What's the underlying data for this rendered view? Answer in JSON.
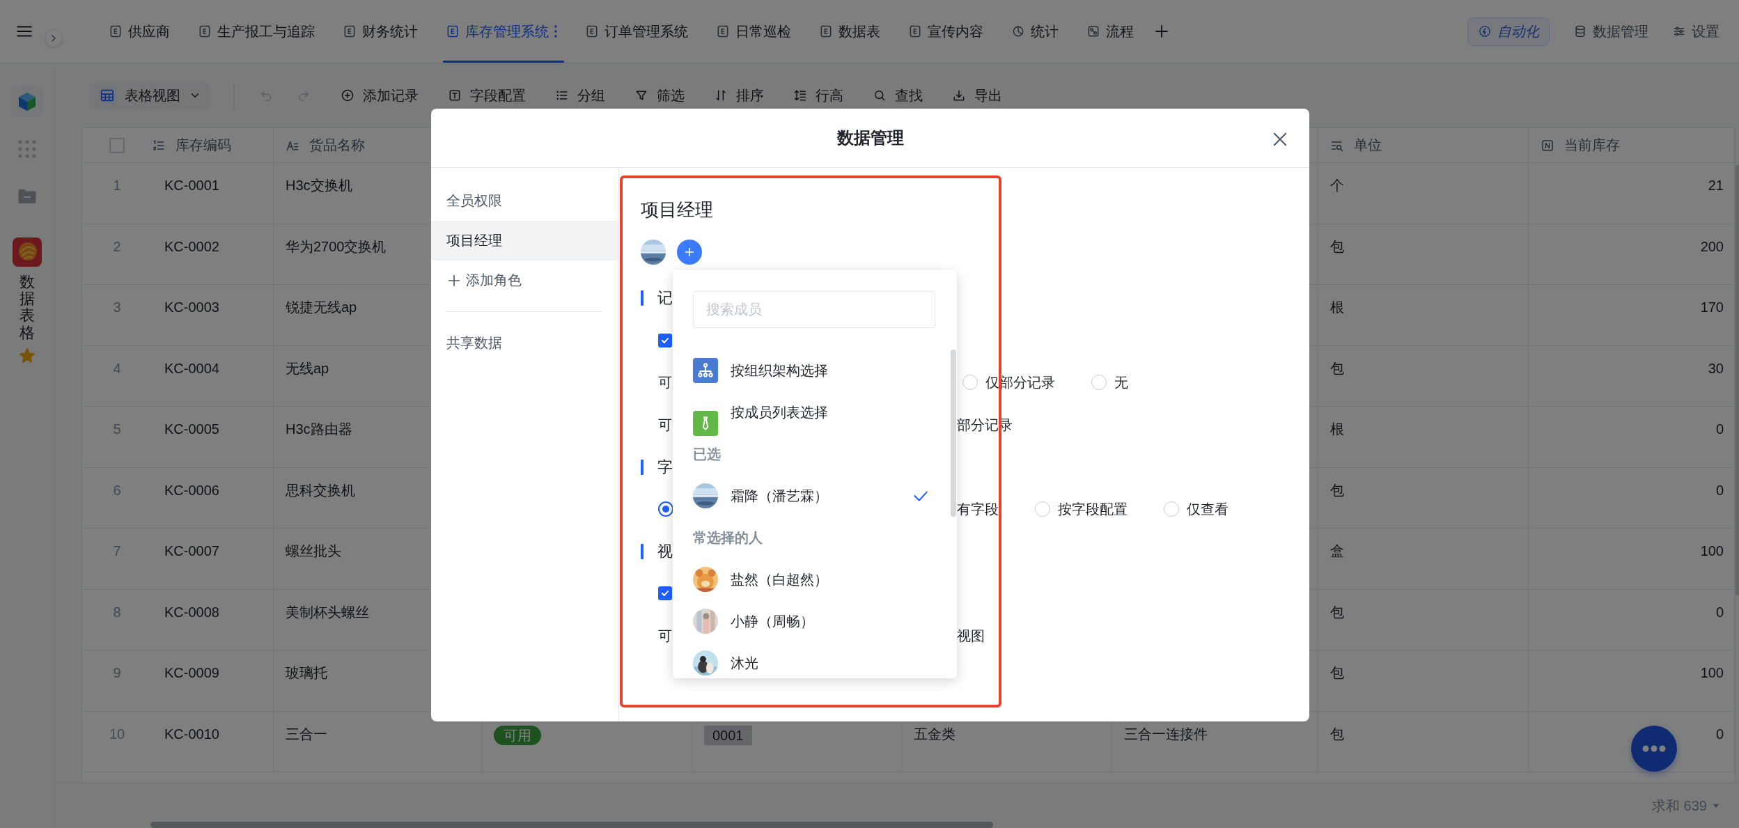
{
  "topbar": {
    "tabs": [
      {
        "label": "供应商",
        "kind": "doc",
        "selected": false
      },
      {
        "label": "生产报工与追踪",
        "kind": "doc",
        "selected": false
      },
      {
        "label": "财务统计",
        "kind": "doc",
        "selected": false
      },
      {
        "label": "库存管理系统",
        "kind": "doc",
        "selected": true
      },
      {
        "label": "订单管理系统",
        "kind": "doc",
        "selected": false
      },
      {
        "label": "日常巡检",
        "kind": "doc",
        "selected": false
      },
      {
        "label": "数据表",
        "kind": "doc",
        "selected": false
      },
      {
        "label": "宣传内容",
        "kind": "doc",
        "selected": false
      },
      {
        "label": "统计",
        "kind": "chart",
        "selected": false
      },
      {
        "label": "流程",
        "kind": "flow",
        "selected": false
      }
    ],
    "actions": [
      {
        "label": "自动化",
        "kind": "automation"
      },
      {
        "label": "数据管理",
        "kind": "database"
      },
      {
        "label": "设置",
        "kind": "settings"
      }
    ]
  },
  "sidebar": {
    "app_label": "数据表格"
  },
  "toolbar": {
    "view": "表格视图",
    "items": [
      {
        "label": "添加记录",
        "kind": "add"
      },
      {
        "label": "字段配置",
        "kind": "field"
      },
      {
        "label": "分组",
        "kind": "group"
      },
      {
        "label": "筛选",
        "kind": "filter"
      },
      {
        "label": "排序",
        "kind": "sort"
      },
      {
        "label": "行高",
        "kind": "height"
      },
      {
        "label": "查找",
        "kind": "find"
      },
      {
        "label": "导出",
        "kind": "export"
      }
    ]
  },
  "table": {
    "select_all": {
      "checked": false
    },
    "columns": [
      {
        "label": "库存编码",
        "kind": "autonumber"
      },
      {
        "label": "货品名称",
        "kind": "text"
      },
      {
        "label": "单位",
        "kind": "lookup"
      },
      {
        "label": "当前库存",
        "kind": "number"
      }
    ],
    "rows": [
      {
        "number": "1",
        "code": "KC-0001",
        "name": "H3c交换机",
        "unit": "个",
        "stock": "21"
      },
      {
        "number": "2",
        "code": "KC-0002",
        "name": "华为2700交换机",
        "unit": "包",
        "stock": "200"
      },
      {
        "number": "3",
        "code": "KC-0003",
        "name": "锐捷无线ap",
        "unit": "根",
        "stock": "170"
      },
      {
        "number": "4",
        "code": "KC-0004",
        "name": "无线ap",
        "unit": "包",
        "stock": "30"
      },
      {
        "number": "5",
        "code": "KC-0005",
        "name": "H3c路由器",
        "unit": "根",
        "stock": "0"
      },
      {
        "number": "6",
        "code": "KC-0006",
        "name": "思科交换机",
        "unit": "包",
        "stock": "0"
      },
      {
        "number": "7",
        "code": "KC-0007",
        "name": "螺丝批头",
        "unit": "盒",
        "stock": "100"
      },
      {
        "number": "8",
        "code": "KC-0008",
        "name": "美制杯头螺丝",
        "unit": "包",
        "stock": "0"
      },
      {
        "number": "9",
        "code": "KC-0009",
        "name": "玻璃托",
        "unit": "包",
        "stock": "100"
      },
      {
        "number": "10",
        "code": "KC-0010",
        "name": "三合一",
        "column_3": "可用",
        "column_4": "0001",
        "column_5": "五金类",
        "column_6": "三合一连接件",
        "unit": "包",
        "stock": "0"
      }
    ]
  },
  "footer": {
    "summary": "求和 639"
  },
  "modal": {
    "title": "数据管理",
    "roles": [
      {
        "label": "全员权限",
        "selected": false
      },
      {
        "label": "项目经理",
        "selected": true
      }
    ],
    "add_role": "添加角色",
    "shared": "共享数据",
    "panel": {
      "heading": "项目经理",
      "rows": [
        {
          "kind": "section",
          "title": "记"
        },
        {
          "kind": "checkbox",
          "checked": true
        },
        {
          "kind": "text",
          "text": "可",
          "right": [
            {
              "kind": "radio",
              "label": "仅部分记录",
              "selected": false
            },
            {
              "kind": "radio",
              "label": "无",
              "selected": false
            }
          ]
        },
        {
          "kind": "text",
          "text": "可",
          "right": [
            {
              "kind": "text",
              "text": "部分记录"
            }
          ]
        },
        {
          "kind": "section",
          "title": "字"
        },
        {
          "kind": "radio",
          "selected": true,
          "right": [
            {
              "kind": "text",
              "text": "有字段"
            },
            {
              "kind": "radio",
              "label": "按字段配置",
              "selected": false
            },
            {
              "kind": "radio",
              "label": "仅查看",
              "selected": false
            }
          ]
        },
        {
          "kind": "section",
          "title": "视"
        },
        {
          "kind": "checkbox",
          "checked": true
        },
        {
          "kind": "text",
          "text": "可",
          "right": [
            {
              "kind": "text",
              "text": "视图"
            }
          ]
        }
      ]
    },
    "member_picker": {
      "search": {
        "placeholder": "搜索成员"
      },
      "sources": [
        {
          "label": "按组织架构选择",
          "kind": "org"
        },
        {
          "label": "按成员列表选择",
          "kind": "list"
        }
      ],
      "groups": [
        {
          "title": "已选",
          "members": [
            {
              "name": "霜降（潘艺霖）",
              "selected": true
            }
          ]
        },
        {
          "title": "常选择的人",
          "members": [
            {
              "name": "盐然（白超然）",
              "selected": false
            },
            {
              "name": "小静（周畅）",
              "selected": false
            },
            {
              "name": "沐光",
              "selected": false
            }
          ]
        }
      ]
    }
  }
}
